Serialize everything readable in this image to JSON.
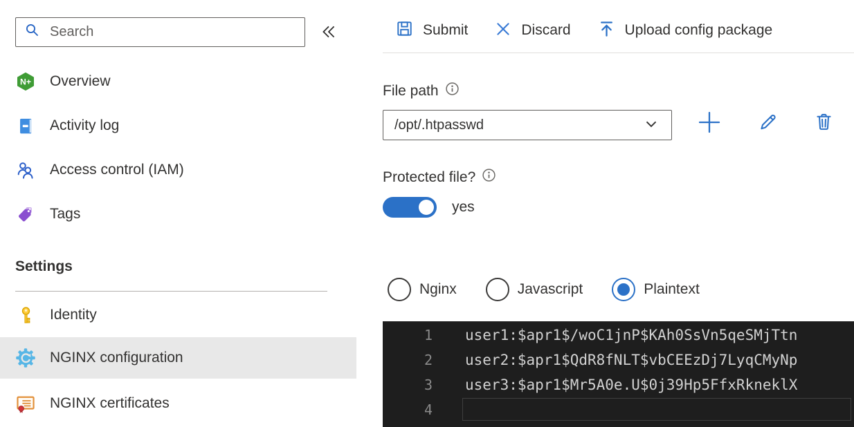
{
  "sidebar": {
    "search": {
      "placeholder": "Search"
    },
    "nav": [
      {
        "label": "Overview",
        "icon": "nginx-logo"
      },
      {
        "label": "Activity log",
        "icon": "activity-log"
      },
      {
        "label": "Access control (IAM)",
        "icon": "access-control"
      },
      {
        "label": "Tags",
        "icon": "tags"
      }
    ],
    "settings_heading": "Settings",
    "settings_nav": [
      {
        "label": "Identity",
        "icon": "key",
        "selected": false
      },
      {
        "label": "NGINX configuration",
        "icon": "gear",
        "selected": true
      },
      {
        "label": "NGINX certificates",
        "icon": "certificate",
        "selected": false
      }
    ]
  },
  "toolbar": {
    "submit_label": "Submit",
    "discard_label": "Discard",
    "upload_label": "Upload config package"
  },
  "form": {
    "file_path_label": "File path",
    "file_path_value": "/opt/.htpasswd",
    "protected_label": "Protected file?",
    "toggle_on": true,
    "toggle_state_label": "yes",
    "radio_options": [
      {
        "label": "Nginx",
        "selected": false
      },
      {
        "label": "Javascript",
        "selected": false
      },
      {
        "label": "Plaintext",
        "selected": true
      }
    ]
  },
  "editor": {
    "lines": [
      {
        "number": "1",
        "text": "user1:$apr1$/woC1jnP$KAh0SsVn5qeSMjTtn"
      },
      {
        "number": "2",
        "text": "user2:$apr1$QdR8fNLT$vbCEEzDj7LyqCMyNp"
      },
      {
        "number": "3",
        "text": "user3:$apr1$Mr5A0e.U$0j39Hp5FfxRkneklX"
      },
      {
        "number": "4",
        "text": ""
      }
    ]
  },
  "colors": {
    "accent": "#2b71c7",
    "selected_row_bg": "#e8e8e8",
    "editor_bg": "#1e1e1e",
    "editor_text": "#d2d2d2",
    "editor_line_number": "#8a8a8a",
    "nginx_green": "#3f9c35",
    "tag_purple": "#8a4fd0",
    "key_gold": "#ffce3f",
    "certificate_orange": "#e2903a"
  }
}
